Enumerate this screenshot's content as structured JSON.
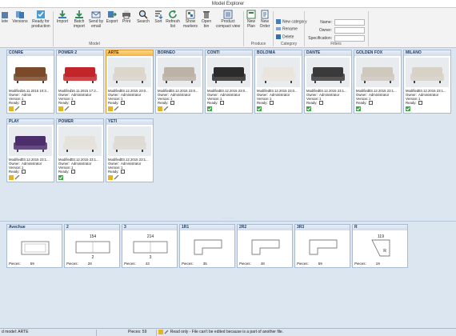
{
  "window": {
    "title": "Model Explorer"
  },
  "ribbon": {
    "buttons": [
      {
        "id": "delete",
        "label": "lete"
      },
      {
        "id": "versions",
        "label": "Versions"
      },
      {
        "id": "ready",
        "label": "Ready for production"
      },
      {
        "id": "import",
        "label": "Import"
      },
      {
        "id": "batch",
        "label": "Batch import"
      },
      {
        "id": "send",
        "label": "Send by email"
      },
      {
        "id": "export",
        "label": "Export"
      },
      {
        "id": "print",
        "label": "Print"
      },
      {
        "id": "search",
        "label": "Search"
      },
      {
        "id": "sort",
        "label": "Sort"
      },
      {
        "id": "refresh",
        "label": "Refresh list"
      },
      {
        "id": "show",
        "label": "Show markers"
      },
      {
        "id": "open",
        "label": "Open bin"
      },
      {
        "id": "compact",
        "label": "Product compact view"
      },
      {
        "id": "newplan",
        "label": "New Plan"
      },
      {
        "id": "neworder",
        "label": "New Order"
      }
    ],
    "groups": {
      "model": "Model",
      "produce": "Produce",
      "category": "Category",
      "filters": "Filters"
    },
    "category_items": {
      "new": "New category",
      "rename": "Rename",
      "delete": "Delete"
    },
    "filters": {
      "name_label": "Name:",
      "owner_label": "Owner:",
      "spec_label": "Specification:",
      "name_value": "",
      "owner_value": "",
      "spec_value": ""
    }
  },
  "meta_labels": {
    "modified": "Modified:",
    "owner": "Owner:",
    "version": "Version:",
    "ready": "Ready:",
    "pieces": "Pieces:"
  },
  "models": [
    {
      "name": "CONRE",
      "modified": "16.11.2015 10:3...",
      "owner": "Admin",
      "version": "1",
      "status": "edit"
    },
    {
      "name": "POWER 2",
      "modified": "16.11.2015 17:2...",
      "owner": "Administrator",
      "version": "1",
      "status": "edit"
    },
    {
      "name": "ARTE",
      "modified": "03.12.2015 23:0...",
      "owner": "Administrator",
      "version": "1",
      "status": "edit",
      "selected": true
    },
    {
      "name": "BORNEO",
      "modified": "03.12.2015 23:0...",
      "owner": "Administrator",
      "version": "1",
      "status": "edit"
    },
    {
      "name": "CONTI",
      "modified": "03.12.2015 23:0...",
      "owner": "Administrator",
      "version": "1",
      "status": "ok"
    },
    {
      "name": "BOLONIA",
      "modified": "03.12.2015 23:0...",
      "owner": "Administrator",
      "version": "1",
      "status": "ok"
    },
    {
      "name": "DANTE",
      "modified": "03.12.2015 23:1...",
      "owner": "Administrator",
      "version": "1",
      "status": "ok"
    },
    {
      "name": "GOLDEN FOX",
      "modified": "03.12.2015 23:1...",
      "owner": "Administrator",
      "version": "1",
      "status": "ok"
    },
    {
      "name": "MILANO",
      "modified": "03.12.2015 23:1...",
      "owner": "Administrator",
      "version": "1",
      "status": "ok"
    },
    {
      "name": "PLAY",
      "modified": "03.12.2015 23:1...",
      "owner": "Administrator",
      "version": "1",
      "status": "edit"
    },
    {
      "name": "POWER",
      "modified": "03.12.2015 23:1...",
      "owner": "Administrator",
      "version": "1",
      "status": "ok"
    },
    {
      "name": "YETI",
      "modified": "03.12.2015 23:1...",
      "owner": "Administrator",
      "version": "1",
      "status": "edit"
    }
  ],
  "parts": [
    {
      "name": "Avechue",
      "pieces": "59",
      "dims": [
        "",
        ""
      ],
      "num": ""
    },
    {
      "name": "2",
      "pieces": "28",
      "dims": [
        "154",
        ""
      ],
      "num": "2"
    },
    {
      "name": "3",
      "pieces": "43",
      "dims": [
        "214",
        ""
      ],
      "num": "3"
    },
    {
      "name": "1R1",
      "pieces": "35",
      "dims": [
        "",
        ""
      ],
      "num": ""
    },
    {
      "name": "2R2",
      "pieces": "48",
      "dims": [
        "",
        ""
      ],
      "num": ""
    },
    {
      "name": "3R3",
      "pieces": "59",
      "dims": [
        "",
        ""
      ],
      "num": ""
    },
    {
      "name": "R",
      "pieces": "19",
      "dims": [
        "119",
        ""
      ],
      "num": "R"
    }
  ],
  "status": {
    "model": "d model: ARTE",
    "pieces_label": "Pieces:",
    "pieces_value": "59",
    "message": "Read only - File can't be edited because is a part of another file."
  }
}
